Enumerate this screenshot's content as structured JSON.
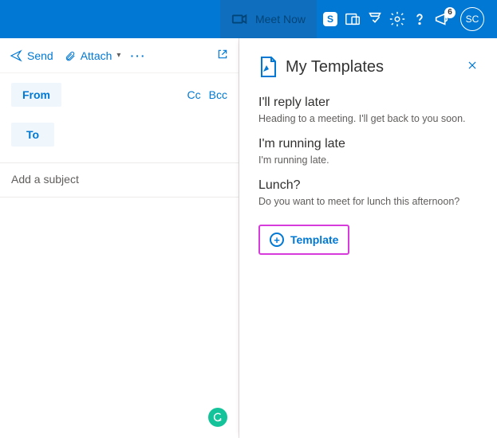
{
  "header": {
    "meet_now": "Meet Now",
    "badge_count": "6",
    "avatar_initials": "SC",
    "skype_letter": "S"
  },
  "toolbar": {
    "send_label": "Send",
    "attach_label": "Attach",
    "more_label": "···"
  },
  "fields": {
    "from_label": "From",
    "to_label": "To",
    "cc_label": "Cc",
    "bcc_label": "Bcc",
    "subject_placeholder": "Add a subject"
  },
  "panel": {
    "title": "My Templates",
    "templates": [
      {
        "title": "I'll reply later",
        "body": "Heading to a meeting. I'll get back to you soon."
      },
      {
        "title": "I'm running late",
        "body": "I'm running late."
      },
      {
        "title": "Lunch?",
        "body": "Do you want to meet for lunch this afternoon?"
      }
    ],
    "add_label": "Template"
  }
}
